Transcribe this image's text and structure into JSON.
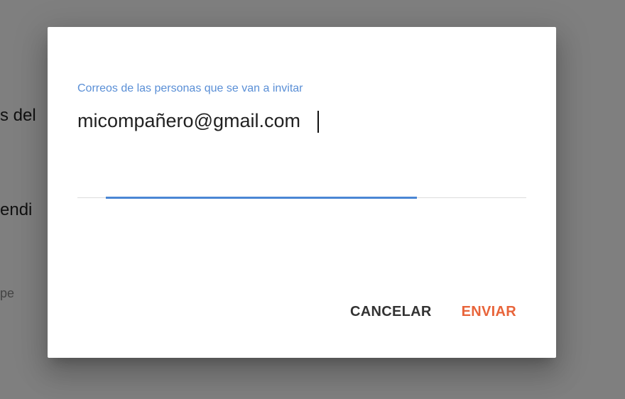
{
  "background": {
    "text_1": "s del",
    "text_2": "endi",
    "text_3": "pe"
  },
  "dialog": {
    "field_label": "Correos de las personas que se van a invitar",
    "field_value": "micompañero@gmail.com",
    "cancel_label": "CANCELAR",
    "send_label": "ENVIAR"
  },
  "colors": {
    "label": "#5a8fd6",
    "focus_underline": "#4a86d4",
    "send_button": "#e8643a",
    "cancel_button": "#333333"
  }
}
